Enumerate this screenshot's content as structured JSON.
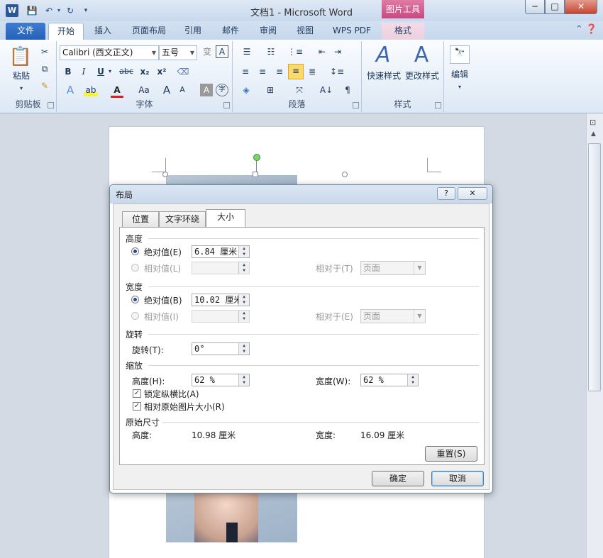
{
  "titlebar": {
    "title": "文档1 - Microsoft Word",
    "picture_tools": "图片工具",
    "app_icon": "W"
  },
  "window_buttons": {
    "minimize": "─",
    "maximize": "□",
    "close": "✕"
  },
  "tabs": [
    {
      "label": "文件"
    },
    {
      "label": "开始"
    },
    {
      "label": "插入"
    },
    {
      "label": "页面布局"
    },
    {
      "label": "引用"
    },
    {
      "label": "邮件"
    },
    {
      "label": "审阅"
    },
    {
      "label": "视图"
    },
    {
      "label": "WPS PDF"
    },
    {
      "label": "格式"
    }
  ],
  "ribbon": {
    "clipboard": {
      "label": "剪贴板",
      "paste": "粘贴"
    },
    "font": {
      "label": "字体",
      "font_name": "Calibri (西文正文)",
      "font_size": "五号",
      "bold": "B",
      "italic": "I",
      "underline": "U",
      "strike": "abc",
      "sub": "x₂",
      "sup": "x²",
      "grow": "A",
      "shrink": "A",
      "case": "Aa"
    },
    "paragraph": {
      "label": "段落"
    },
    "styles": {
      "label": "样式",
      "quick": "快速样式",
      "change": "更改样式"
    },
    "editing": {
      "label": "编辑"
    }
  },
  "dialog": {
    "title": "布局",
    "help": "?",
    "close": "✕",
    "tabs": [
      "位置",
      "文字环绕",
      "大小"
    ],
    "height": {
      "section": "高度",
      "absolute_label": "绝对值(E)",
      "absolute_value": "6.84 厘米",
      "relative_label": "相对值(L)",
      "relative_to_label": "相对于(T)",
      "relative_to_value": "页面"
    },
    "width": {
      "section": "宽度",
      "absolute_label": "绝对值(B)",
      "absolute_value": "10.02 厘米",
      "relative_label": "相对值(I)",
      "relative_to_label": "相对于(E)",
      "relative_to_value": "页面"
    },
    "rotate": {
      "section": "旋转",
      "label": "旋转(T):",
      "value": "0°"
    },
    "scale": {
      "section": "缩放",
      "height_label": "高度(H):",
      "height_value": "62 %",
      "width_label": "宽度(W):",
      "width_value": "62 %",
      "lock_aspect": "锁定纵横比(A)",
      "relative_original": "相对原始图片大小(R)"
    },
    "original": {
      "section": "原始尺寸",
      "height_label": "高度:",
      "height_value": "10.98 厘米",
      "width_label": "宽度:",
      "width_value": "16.09 厘米"
    },
    "reset": "重置(S)",
    "ok": "确定",
    "cancel": "取消"
  }
}
